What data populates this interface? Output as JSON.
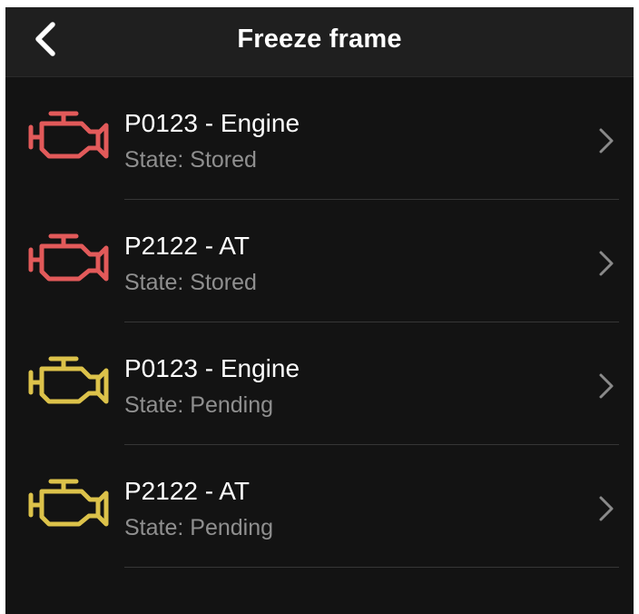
{
  "header": {
    "title": "Freeze frame",
    "back_icon": "chevron-left-icon"
  },
  "colors": {
    "background": "#131313",
    "nav_background": "#1f1f1f",
    "stored": "#e25a5a",
    "pending": "#dcc24a",
    "secondary_text": "#8f8f8f"
  },
  "dtc_list": [
    {
      "code": "P0123 - Engine",
      "state": "State: Stored",
      "icon": "engine-warning-icon",
      "icon_color": "#e25a5a"
    },
    {
      "code": "P2122 - AT",
      "state": "State: Stored",
      "icon": "engine-warning-icon",
      "icon_color": "#e25a5a"
    },
    {
      "code": "P0123 - Engine",
      "state": "State: Pending",
      "icon": "engine-warning-icon",
      "icon_color": "#dcc24a"
    },
    {
      "code": "P2122 - AT",
      "state": "State: Pending",
      "icon": "engine-warning-icon",
      "icon_color": "#dcc24a"
    }
  ]
}
